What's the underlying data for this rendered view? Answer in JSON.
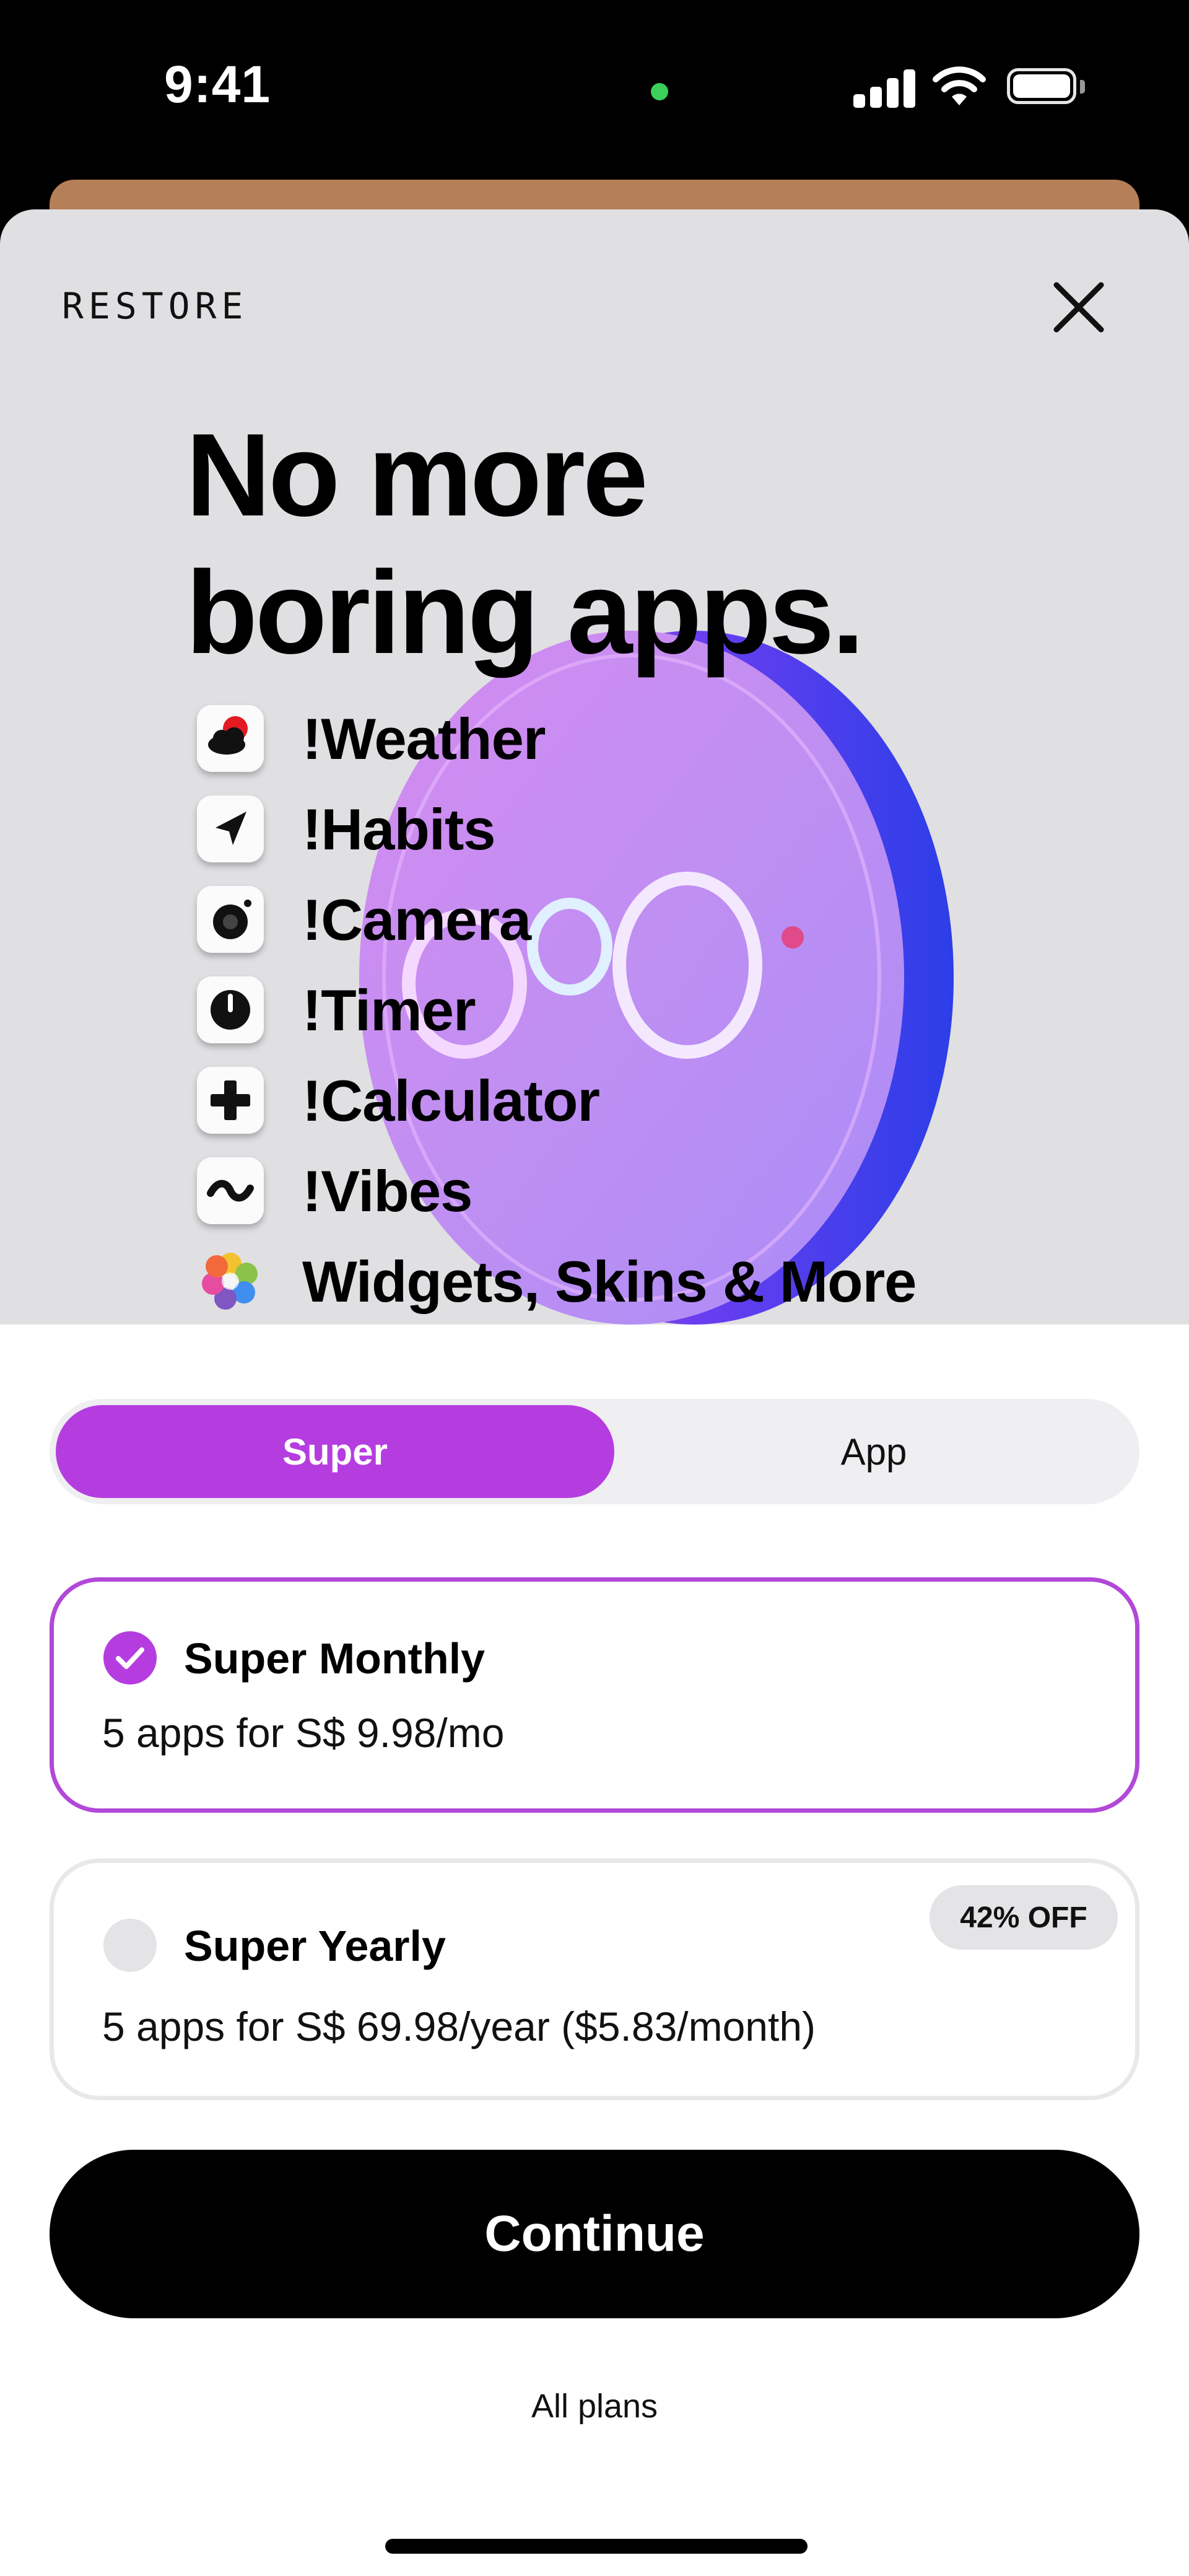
{
  "status_bar": {
    "time": "9:41"
  },
  "header": {
    "restore_label": "RESTORE",
    "close_icon": "close-icon"
  },
  "hero": {
    "headline_line1": "No more",
    "headline_line2": "boring apps.",
    "features": [
      {
        "label": "!Weather",
        "icon": "weather-icon"
      },
      {
        "label": "!Habits",
        "icon": "habits-icon"
      },
      {
        "label": "!Camera",
        "icon": "camera-icon"
      },
      {
        "label": "!Timer",
        "icon": "timer-icon"
      },
      {
        "label": "!Calculator",
        "icon": "calculator-icon"
      },
      {
        "label": "!Vibes",
        "icon": "vibes-icon"
      },
      {
        "label": "Widgets, Skins & More",
        "icon": "flower-icon"
      }
    ]
  },
  "segment": {
    "super_label": "Super",
    "app_label": "App",
    "selected": "Super"
  },
  "plans": [
    {
      "title": "Super Monthly",
      "desc": "5 apps for S$ 9.98/mo",
      "selected": true
    },
    {
      "title": "Super Yearly",
      "desc": "5 apps for S$ 69.98/year ($5.83/month)",
      "badge": "42% OFF",
      "selected": false
    }
  ],
  "cta": {
    "continue_label": "Continue",
    "all_plans_label": "All plans"
  },
  "colors": {
    "accent": "#b53de0",
    "hero_bg": "#e0dfe2",
    "cta_bg": "#000000"
  }
}
